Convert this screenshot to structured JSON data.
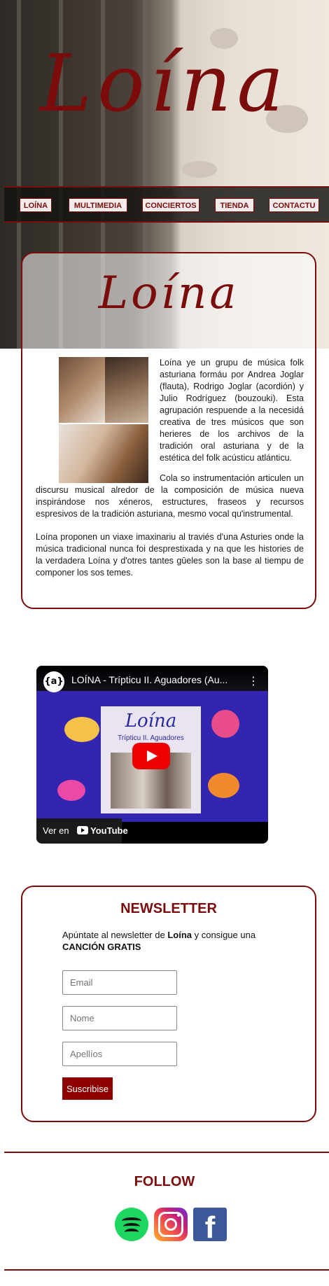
{
  "hero": {
    "title": "Loína"
  },
  "nav": {
    "items": [
      {
        "label": "LOÍNA"
      },
      {
        "label": "MULTIMEDIA"
      },
      {
        "label": "CONCIERTOS"
      },
      {
        "label": "TIENDA"
      },
      {
        "label": "CONTACTU"
      }
    ]
  },
  "about": {
    "title": "Loína",
    "paragraphs": [
      "Loína ye un grupu de música folk asturiana formáu por Andrea Joglar (flauta), Rodrigo Joglar (acordión) y Julio Rodríguez (bouzouki). Esta agrupación respuende a la necesidá creativa de tres músicos que son herieres de los archivos de la tradición oral asturiana y de la estética del folk acústicu atlánticu.",
      "Cola so instrumentación articulen un discursu musical alredor de la composición de música nueva inspirándose nos xéneros, estructures, fraseos y recursos espresivos de la tradición asturiana, mesmo vocal qu'instrumental.",
      "Loína proponen un viaxe imaxinariu al traviés d'una Asturies onde la música tradicional nunca foi desprestixada y na que les histories de la verdadera Loína y d'otres tantes gūeles son la base al tiempu de componer los sos temes."
    ]
  },
  "video": {
    "channel_badge": "{a}",
    "title": "LOÍNA - Trípticu II. Aguadores (Au...",
    "cover_title": "Loína",
    "cover_subtitle": "Trípticu II. Aguadores",
    "watch_on": "Ver en",
    "brand": "YouTube"
  },
  "newsletter": {
    "title": "NEWSLETTER",
    "text_pre": "Apúntate al newsletter de ",
    "text_bold1": "Loína",
    "text_mid": " y consigue una ",
    "text_bold2": "CANCIÓN GRATIS",
    "fields": [
      {
        "placeholder": "Email"
      },
      {
        "placeholder": "Nome"
      },
      {
        "placeholder": "Apellíos"
      }
    ],
    "submit_label": "Suscribise"
  },
  "follow": {
    "title": "FOLLOW",
    "icons": [
      "spotify-icon",
      "instagram-icon",
      "facebook-icon"
    ]
  },
  "colors": {
    "accent": "#7a0c0c",
    "button": "#8e0000"
  }
}
